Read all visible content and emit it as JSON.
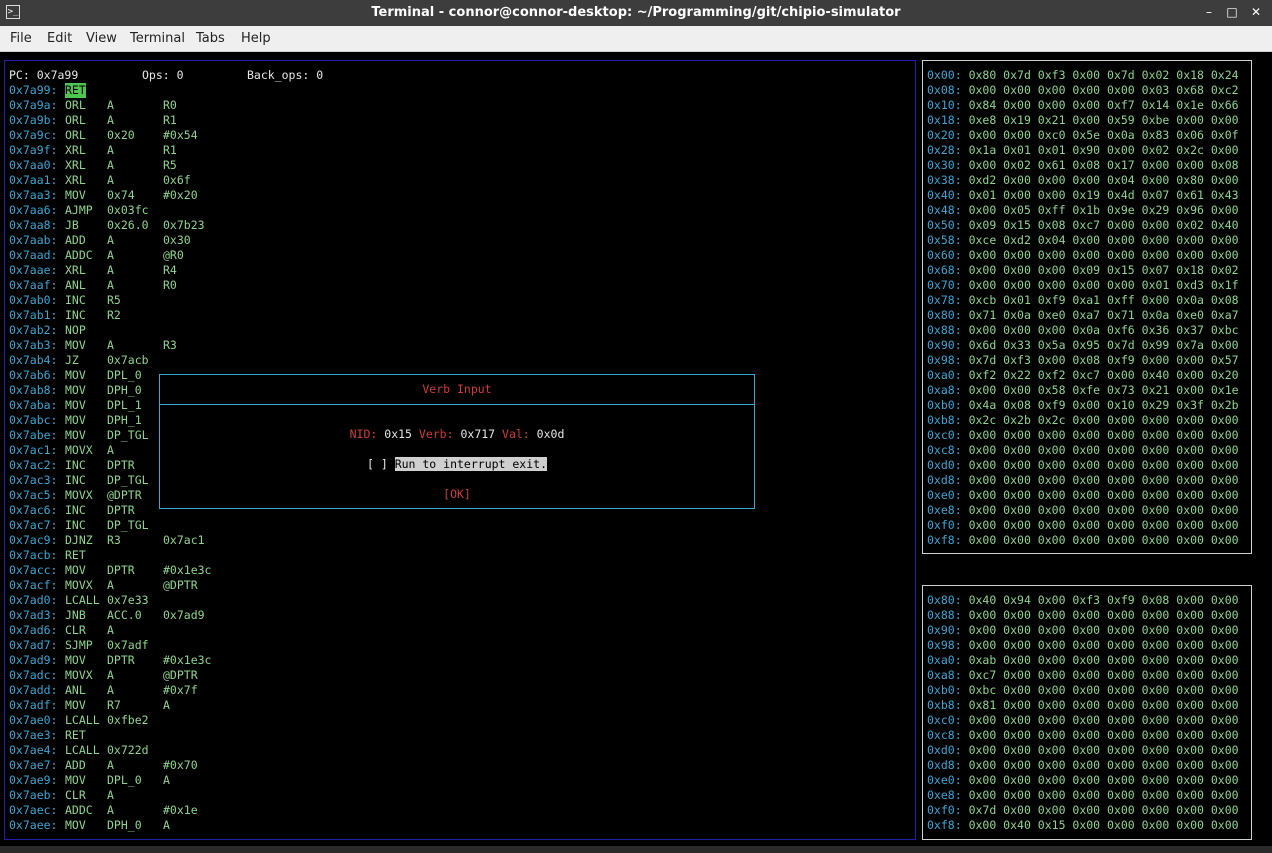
{
  "window": {
    "title": "Terminal - connor@connor-desktop: ~/Programming/git/chipio-simulator",
    "buttons": {
      "minimize": "–",
      "maximize": "□",
      "close": "✕"
    }
  },
  "menu": [
    "File",
    "Edit",
    "View",
    "Terminal",
    "Tabs",
    "Help"
  ],
  "status": {
    "pc_label": "PC:",
    "pc": "0x7a99",
    "ops_label": "Ops:",
    "ops": "0",
    "back_ops_label": "Back_ops:",
    "back_ops": "0"
  },
  "disasm": [
    [
      "0x7a99:",
      "RET",
      "",
      ""
    ],
    [
      "0x7a9a:",
      "ORL",
      "A",
      "R0"
    ],
    [
      "0x7a9b:",
      "ORL",
      "A",
      "R1"
    ],
    [
      "0x7a9c:",
      "ORL",
      "0x20",
      "#0x54"
    ],
    [
      "0x7a9f:",
      "XRL",
      "A",
      "R1"
    ],
    [
      "0x7aa0:",
      "XRL",
      "A",
      "R5"
    ],
    [
      "0x7aa1:",
      "XRL",
      "A",
      "0x6f"
    ],
    [
      "0x7aa3:",
      "MOV",
      "0x74",
      "#0x20"
    ],
    [
      "0x7aa6:",
      "AJMP",
      "0x03fc",
      ""
    ],
    [
      "0x7aa8:",
      "JB",
      "0x26.0",
      "0x7b23"
    ],
    [
      "0x7aab:",
      "ADD",
      "A",
      "0x30"
    ],
    [
      "0x7aad:",
      "ADDC",
      "A",
      "@R0"
    ],
    [
      "0x7aae:",
      "XRL",
      "A",
      "R4"
    ],
    [
      "0x7aaf:",
      "ANL",
      "A",
      "R0"
    ],
    [
      "0x7ab0:",
      "INC",
      "R5",
      ""
    ],
    [
      "0x7ab1:",
      "INC",
      "R2",
      ""
    ],
    [
      "0x7ab2:",
      "NOP",
      "",
      ""
    ],
    [
      "0x7ab3:",
      "MOV",
      "A",
      "R3"
    ],
    [
      "0x7ab4:",
      "JZ",
      "0x7acb",
      ""
    ],
    [
      "0x7ab6:",
      "MOV",
      "DPL_0",
      ""
    ],
    [
      "0x7ab8:",
      "MOV",
      "DPH_0",
      ""
    ],
    [
      "0x7aba:",
      "MOV",
      "DPL_1",
      ""
    ],
    [
      "0x7abc:",
      "MOV",
      "DPH_1",
      ""
    ],
    [
      "0x7abe:",
      "MOV",
      "DP_TGL",
      ""
    ],
    [
      "0x7ac1:",
      "MOVX",
      "A",
      ""
    ],
    [
      "0x7ac2:",
      "INC",
      "DPTR",
      ""
    ],
    [
      "0x7ac3:",
      "INC",
      "DP_TGL",
      ""
    ],
    [
      "0x7ac5:",
      "MOVX",
      "@DPTR",
      ""
    ],
    [
      "0x7ac6:",
      "INC",
      "DPTR",
      ""
    ],
    [
      "0x7ac7:",
      "INC",
      "DP_TGL",
      ""
    ],
    [
      "0x7ac9:",
      "DJNZ",
      "R3",
      "0x7ac1"
    ],
    [
      "0x7acb:",
      "RET",
      "",
      ""
    ],
    [
      "0x7acc:",
      "MOV",
      "DPTR",
      "#0x1e3c"
    ],
    [
      "0x7acf:",
      "MOVX",
      "A",
      "@DPTR"
    ],
    [
      "0x7ad0:",
      "LCALL",
      "0x7e33",
      ""
    ],
    [
      "0x7ad3:",
      "JNB",
      "ACC.0",
      "0x7ad9"
    ],
    [
      "0x7ad6:",
      "CLR",
      "A",
      ""
    ],
    [
      "0x7ad7:",
      "SJMP",
      "0x7adf",
      ""
    ],
    [
      "0x7ad9:",
      "MOV",
      "DPTR",
      "#0x1e3c"
    ],
    [
      "0x7adc:",
      "MOVX",
      "A",
      "@DPTR"
    ],
    [
      "0x7add:",
      "ANL",
      "A",
      "#0x7f"
    ],
    [
      "0x7adf:",
      "MOV",
      "R7",
      "A"
    ],
    [
      "0x7ae0:",
      "LCALL",
      "0xfbe2",
      ""
    ],
    [
      "0x7ae3:",
      "RET",
      "",
      ""
    ],
    [
      "0x7ae4:",
      "LCALL",
      "0x722d",
      ""
    ],
    [
      "0x7ae7:",
      "ADD",
      "A",
      "#0x70"
    ],
    [
      "0x7ae9:",
      "MOV",
      "DPL_0",
      "A"
    ],
    [
      "0x7aeb:",
      "CLR",
      "A",
      ""
    ],
    [
      "0x7aec:",
      "ADDC",
      "A",
      "#0x1e"
    ],
    [
      "0x7aee:",
      "MOV",
      "DPH_0",
      "A"
    ]
  ],
  "iram": [
    [
      "0x00:",
      "0x80 0x7d 0xf3 0x00 0x7d 0x02 0x18 0x24"
    ],
    [
      "0x08:",
      "0x00 0x00 0x00 0x00 0x00 0x03 0x68 0xc2"
    ],
    [
      "0x10:",
      "0x84 0x00 0x00 0x00 0xf7 0x14 0x1e 0x66"
    ],
    [
      "0x18:",
      "0xe8 0x19 0x21 0x00 0x59 0xbe 0x00 0x00"
    ],
    [
      "0x20:",
      "0x00 0x00 0xc0 0x5e 0x0a 0x83 0x06 0x0f"
    ],
    [
      "0x28:",
      "0x1a 0x01 0x01 0x90 0x00 0x02 0x2c 0x00"
    ],
    [
      "0x30:",
      "0x00 0x02 0x61 0x08 0x17 0x00 0x00 0x08"
    ],
    [
      "0x38:",
      "0xd2 0x00 0x00 0x00 0x04 0x00 0x80 0x00"
    ],
    [
      "0x40:",
      "0x01 0x00 0x00 0x19 0x4d 0x07 0x61 0x43"
    ],
    [
      "0x48:",
      "0x00 0x05 0xff 0x1b 0x9e 0x29 0x96 0x00"
    ],
    [
      "0x50:",
      "0x09 0x15 0x08 0xc7 0x00 0x00 0x02 0x40"
    ],
    [
      "0x58:",
      "0xce 0xd2 0x04 0x00 0x00 0x00 0x00 0x00"
    ],
    [
      "0x60:",
      "0x00 0x00 0x00 0x00 0x00 0x00 0x00 0x00"
    ],
    [
      "0x68:",
      "0x00 0x00 0x00 0x09 0x15 0x07 0x18 0x02"
    ],
    [
      "0x70:",
      "0x00 0x00 0x00 0x00 0x00 0x01 0xd3 0x1f"
    ],
    [
      "0x78:",
      "0xcb 0x01 0xf9 0xa1 0xff 0x00 0x0a 0x08"
    ],
    [
      "0x80:",
      "0x71 0x0a 0xe0 0xa7 0x71 0x0a 0xe0 0xa7"
    ],
    [
      "0x88:",
      "0x00 0x00 0x00 0x0a 0xf6 0x36 0x37 0xbc"
    ],
    [
      "0x90:",
      "0x6d 0x33 0x5a 0x95 0x7d 0x99 0x7a 0x00"
    ],
    [
      "0x98:",
      "0x7d 0xf3 0x00 0x08 0xf9 0x00 0x00 0x57"
    ],
    [
      "0xa0:",
      "0xf2 0x22 0xf2 0xc7 0x00 0x40 0x00 0x20"
    ],
    [
      "0xa8:",
      "0x00 0x00 0x58 0xfe 0x73 0x21 0x00 0x1e"
    ],
    [
      "0xb0:",
      "0x4a 0x08 0xf9 0x00 0x10 0x29 0x3f 0x2b"
    ],
    [
      "0xb8:",
      "0x2c 0x2b 0x2c 0x00 0x00 0x00 0x00 0x00"
    ],
    [
      "0xc0:",
      "0x00 0x00 0x00 0x00 0x00 0x00 0x00 0x00"
    ],
    [
      "0xc8:",
      "0x00 0x00 0x00 0x00 0x00 0x00 0x00 0x00"
    ],
    [
      "0xd0:",
      "0x00 0x00 0x00 0x00 0x00 0x00 0x00 0x00"
    ],
    [
      "0xd8:",
      "0x00 0x00 0x00 0x00 0x00 0x00 0x00 0x00"
    ],
    [
      "0xe0:",
      "0x00 0x00 0x00 0x00 0x00 0x00 0x00 0x00"
    ],
    [
      "0xe8:",
      "0x00 0x00 0x00 0x00 0x00 0x00 0x00 0x00"
    ],
    [
      "0xf0:",
      "0x00 0x00 0x00 0x00 0x00 0x00 0x00 0x00"
    ],
    [
      "0xf8:",
      "0x00 0x00 0x00 0x00 0x00 0x00 0x00 0x00"
    ]
  ],
  "sfr": [
    [
      "0x80:",
      "0x40 0x94 0x00 0xf3 0xf9 0x08 0x00 0x00"
    ],
    [
      "0x88:",
      "0x00 0x00 0x00 0x00 0x00 0x00 0x00 0x00"
    ],
    [
      "0x90:",
      "0x00 0x00 0x00 0x00 0x00 0x00 0x00 0x00"
    ],
    [
      "0x98:",
      "0x00 0x00 0x00 0x00 0x00 0x00 0x00 0x00"
    ],
    [
      "0xa0:",
      "0xab 0x00 0x00 0x00 0x00 0x00 0x00 0x00"
    ],
    [
      "0xa8:",
      "0xc7 0x00 0x00 0x00 0x00 0x00 0x00 0x00"
    ],
    [
      "0xb0:",
      "0xbc 0x00 0x00 0x00 0x00 0x00 0x00 0x00"
    ],
    [
      "0xb8:",
      "0x81 0x00 0x00 0x00 0x00 0x00 0x00 0x00"
    ],
    [
      "0xc0:",
      "0x00 0x00 0x00 0x00 0x00 0x00 0x00 0x00"
    ],
    [
      "0xc8:",
      "0x00 0x00 0x00 0x00 0x00 0x00 0x00 0x00"
    ],
    [
      "0xd0:",
      "0x00 0x00 0x00 0x00 0x00 0x00 0x00 0x00"
    ],
    [
      "0xd8:",
      "0x00 0x00 0x00 0x00 0x00 0x00 0x00 0x00"
    ],
    [
      "0xe0:",
      "0x00 0x00 0x00 0x00 0x00 0x00 0x00 0x00"
    ],
    [
      "0xe8:",
      "0x00 0x00 0x00 0x00 0x00 0x00 0x00 0x00"
    ],
    [
      "0xf0:",
      "0x7d 0x00 0x00 0x00 0x00 0x00 0x00 0x00"
    ],
    [
      "0xf8:",
      "0x00 0x40 0x15 0x00 0x00 0x00 0x00 0x00"
    ]
  ],
  "dialog": {
    "title": "Verb Input",
    "nid_label": "NID:",
    "nid": "0x15",
    "verb_label": "Verb:",
    "verb": "0x717",
    "val_label": "Val:",
    "val": "0x0d",
    "checkbox": "[ ]",
    "checkbox_label": "Run to interrupt exit.",
    "ok": "[OK]"
  },
  "colors": {
    "address": "#3aa6d6",
    "opcode": "#8fd48f",
    "current_highlight": "#4ec54e",
    "dialog_title": "#d13a3a",
    "border": "#1f1fa8"
  }
}
